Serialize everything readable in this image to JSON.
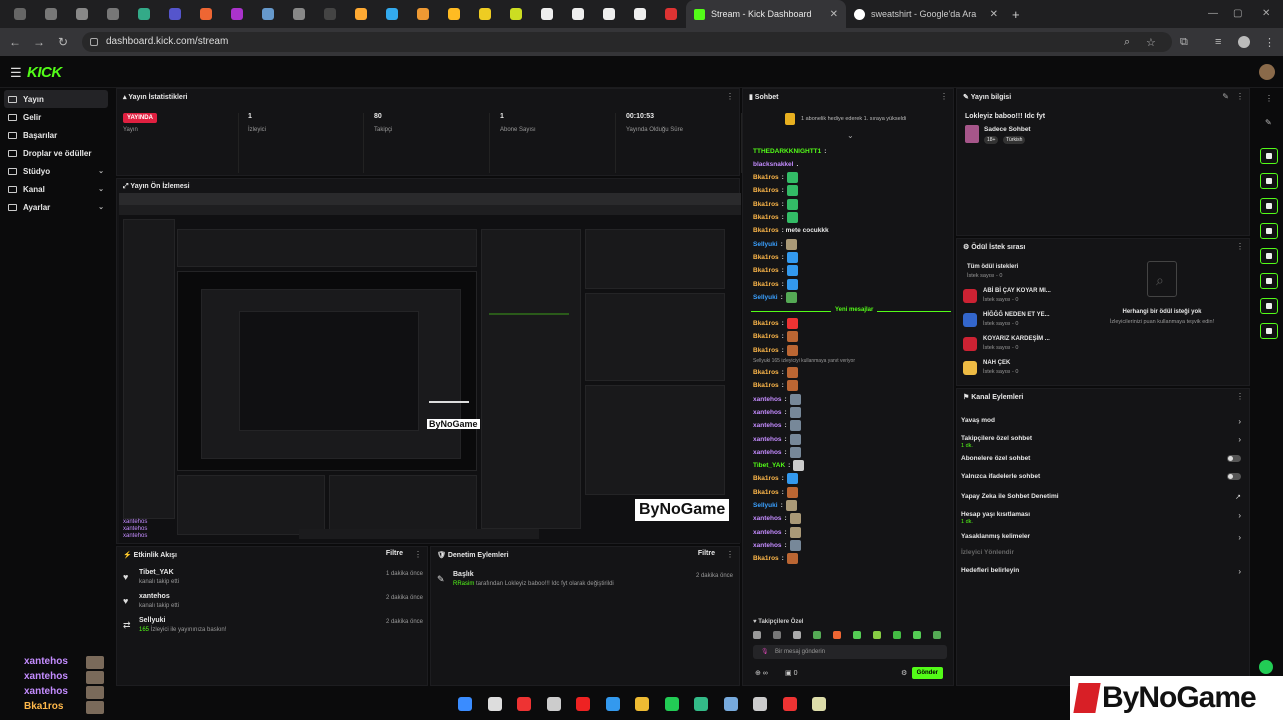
{
  "browser": {
    "tabs": {
      "active_title": "Stream - Kick Dashboard",
      "inactive_title": "sweatshirt - Google'da Ara"
    },
    "url": "dashboard.kick.com/stream",
    "mini_tab_colors": [
      "#666",
      "#777",
      "#888",
      "#777",
      "#3a8",
      "#55c",
      "#e63",
      "#a3c",
      "#69c",
      "#888",
      "#444",
      "#fa3",
      "#3ae",
      "#e93",
      "#fb2",
      "#ec2",
      "#cd2",
      "#eee",
      "#eee",
      "#eee",
      "#eee",
      "#d33"
    ]
  },
  "header": {
    "logo": "KICK"
  },
  "sidebar": {
    "items": [
      {
        "label": "Yayın",
        "chevron": false,
        "active": true
      },
      {
        "label": "Gelir",
        "chevron": false,
        "active": false
      },
      {
        "label": "Başarılar",
        "chevron": false,
        "active": false
      },
      {
        "label": "Droplar ve ödüller",
        "chevron": false,
        "active": false
      },
      {
        "label": "Stüdyo",
        "chevron": true,
        "active": false
      },
      {
        "label": "Kanal",
        "chevron": true,
        "active": false
      },
      {
        "label": "Ayarlar",
        "chevron": true,
        "active": false
      }
    ]
  },
  "stats": {
    "title": "Yayın İstatistikleri",
    "live": "YAYINDA",
    "live_label": "Yayın",
    "items": [
      {
        "value": "1",
        "label": "İzleyici"
      },
      {
        "value": "80",
        "label": "Takipçi"
      },
      {
        "value": "1",
        "label": "Abone Sayısı"
      },
      {
        "value": "00:10:53",
        "label": "Yayında Olduğu Süre"
      }
    ]
  },
  "preview": {
    "title": "Yayın Ön İzlemesi"
  },
  "activity": {
    "title": "Etkinlik Akışı",
    "filter": "Filtre",
    "items": [
      {
        "name": "Tibet_YAK",
        "sub": "kanalı takip etti",
        "time": "1 dakika önce"
      },
      {
        "name": "xantehos",
        "sub": "kanalı takip etti",
        "time": "2 dakika önce"
      },
      {
        "name": "Sellyuki",
        "sub_prefix": "165",
        "sub": "İzleyici ile yayınınıza baskın!",
        "time": "2 dakika önce"
      }
    ]
  },
  "audit": {
    "title": "Denetim Eylemleri",
    "filter": "Filtre",
    "item": {
      "name": "Başlık",
      "text_user": "RRasim",
      "text": "tarafından Lokleyiz baboo!!! Idc fyt olarak değiştirildi",
      "time": "2 dakika önce"
    }
  },
  "chat": {
    "title": "Sohbet",
    "pinned": "1 abonelik hediye ederek 1. sıraya yükseldi",
    "new_messages": "Yeni mesajlar",
    "raid_note": "Sellyuki 165 izleyiciyi kullanmaya yanıt veriyor",
    "messages": [
      {
        "user": "TTHEDARKKNIGHTT1",
        "color": "#53fc18",
        "text": ":",
        "emote": ""
      },
      {
        "user": "blacksnakkel",
        "color": "#c48cff",
        "text": ".",
        "emote": ""
      },
      {
        "user": "Bka1ros",
        "color": "#ffb84a",
        "text": ":",
        "emote": "#3b6"
      },
      {
        "user": "Bka1ros",
        "color": "#ffb84a",
        "text": ":",
        "emote": "#3b6"
      },
      {
        "user": "Bka1ros",
        "color": "#ffb84a",
        "text": ":",
        "emote": "#3b6"
      },
      {
        "user": "Bka1ros",
        "color": "#ffb84a",
        "text": ":",
        "emote": "#3b6"
      },
      {
        "user": "Bka1ros",
        "color": "#ffb84a",
        "text": ": mete cocukkk",
        "emote": ""
      },
      {
        "user": "Sellyuki",
        "color": "#3aa0ff",
        "text": ":",
        "emote": "#a97"
      },
      {
        "user": "Bka1ros",
        "color": "#ffb84a",
        "text": ":",
        "emote": "#39e"
      },
      {
        "user": "Bka1ros",
        "color": "#ffb84a",
        "text": ":",
        "emote": "#39e"
      },
      {
        "user": "Bka1ros",
        "color": "#ffb84a",
        "text": ":",
        "emote": "#39e"
      },
      {
        "user": "Sellyuki",
        "color": "#3aa0ff",
        "text": ":",
        "emote": "#5a5"
      },
      {
        "user": "Bka1ros",
        "color": "#ffb84a",
        "text": ":",
        "emote": "#e33"
      },
      {
        "user": "Bka1ros",
        "color": "#ffb84a",
        "text": ":",
        "emote": "#b63"
      },
      {
        "user": "Bka1ros",
        "color": "#ffb84a",
        "text": ":",
        "emote": "#b63"
      },
      {
        "user": "Bka1ros",
        "color": "#ffb84a",
        "text": ":",
        "emote": "#b63"
      },
      {
        "user": "Bka1ros",
        "color": "#ffb84a",
        "text": ":",
        "emote": "#b63"
      },
      {
        "user": "xantehos",
        "color": "#c48cff",
        "text": ":",
        "emote": "#789"
      },
      {
        "user": "xantehos",
        "color": "#c48cff",
        "text": ":",
        "emote": "#789"
      },
      {
        "user": "xantehos",
        "color": "#c48cff",
        "text": ":",
        "emote": "#789"
      },
      {
        "user": "xantehos",
        "color": "#c48cff",
        "text": ":",
        "emote": "#789"
      },
      {
        "user": "xantehos",
        "color": "#c48cff",
        "text": ":",
        "emote": "#789"
      },
      {
        "user": "Tibet_YAK",
        "color": "#53fc18",
        "text": ":",
        "emote": "#ccc"
      },
      {
        "user": "Bka1ros",
        "color": "#ffb84a",
        "text": ":",
        "emote": "#39e"
      },
      {
        "user": "Bka1ros",
        "color": "#ffb84a",
        "text": ":",
        "emote": "#b63"
      },
      {
        "user": "Sellyuki",
        "color": "#3aa0ff",
        "text": ":",
        "emote": "#a97"
      },
      {
        "user": "xantehos",
        "color": "#c48cff",
        "text": ":",
        "emote": "#a97"
      },
      {
        "user": "xantehos",
        "color": "#c48cff",
        "text": ":",
        "emote": "#a97"
      },
      {
        "user": "xantehos",
        "color": "#c48cff",
        "text": ":",
        "emote": "#789"
      },
      {
        "user": "Bka1ros",
        "color": "#ffb84a",
        "text": ":",
        "emote": "#b63"
      }
    ],
    "section": "Takipçilere Özel",
    "input_placeholder": "Bir mesaj gönderin",
    "counter": "0",
    "send": "Gönder"
  },
  "stream_info": {
    "title": "Yayın bilgisi",
    "stream_title": "Lokleyiz baboo!!! Idc fyt",
    "category": "Sadece Sohbet",
    "tags": [
      "18+",
      "Türkish"
    ]
  },
  "rewards": {
    "title": "Ödül İstek sırası",
    "list": [
      {
        "name": "Tüm ödül istekleri",
        "sub": "İstek sayısı - 0",
        "color": "#333"
      },
      {
        "name": "ABİ Bİ ÇAY KOYAR MI...",
        "sub": "İstek sayısı - 0",
        "color": "#c23"
      },
      {
        "name": "HİĞĞĞ NEDEN ET YE...",
        "sub": "İstek sayısı - 0",
        "color": "#36c"
      },
      {
        "name": "KOYARIZ KARDEŞİM ...",
        "sub": "İstek sayısı - 0",
        "color": "#c23"
      },
      {
        "name": "NAH ÇEK",
        "sub": "İstek sayısı - 0",
        "color": "#eb4"
      }
    ],
    "empty_title": "Herhangi bir ödül isteği yok",
    "empty_sub": "İzleyicilerinizi puan kullanmaya teşvik edin!"
  },
  "channel_actions": {
    "title": "Kanal Eylemleri",
    "items": [
      {
        "label": "Yavaş mod",
        "sub": "",
        "control": "arrow"
      },
      {
        "label": "Takipçilere özel sohbet",
        "sub": "1 dk.",
        "control": "arrow"
      },
      {
        "label": "Abonelere özel sohbet",
        "sub": "",
        "control": "toggle"
      },
      {
        "label": "Yalnızca ifadelerle sohbet",
        "sub": "",
        "control": "toggle"
      },
      {
        "label": "Yapay Zeka ile Sohbet Denetimi",
        "sub": "",
        "control": "link"
      },
      {
        "label": "Hesap yaşı kısıtlaması",
        "sub": "1 dk.",
        "control": "arrow"
      },
      {
        "label": "Yasaklanmış kelimeler",
        "sub": "",
        "control": "arrow"
      },
      {
        "label": "İzleyici Yönlendir",
        "sub": "",
        "control": "none"
      },
      {
        "label": "Hedefleri belirleyin",
        "sub": "",
        "control": "arrow"
      }
    ]
  },
  "overlay": {
    "names": [
      {
        "name": "xantehos",
        "color": "#c48cff"
      },
      {
        "name": "xantehos",
        "color": "#c48cff"
      },
      {
        "name": "xantehos",
        "color": "#c48cff"
      },
      {
        "name": "Bka1ros",
        "color": "#ffb84a"
      }
    ],
    "brand": "ByNoGame"
  },
  "taskbar": {
    "colors": [
      "#3a8cff",
      "#ddd",
      "#e33",
      "#ccc",
      "#e22",
      "#39e",
      "#eb3",
      "#2c5",
      "#3b8",
      "#7ad",
      "#ccc",
      "#e33",
      "#dda"
    ]
  }
}
